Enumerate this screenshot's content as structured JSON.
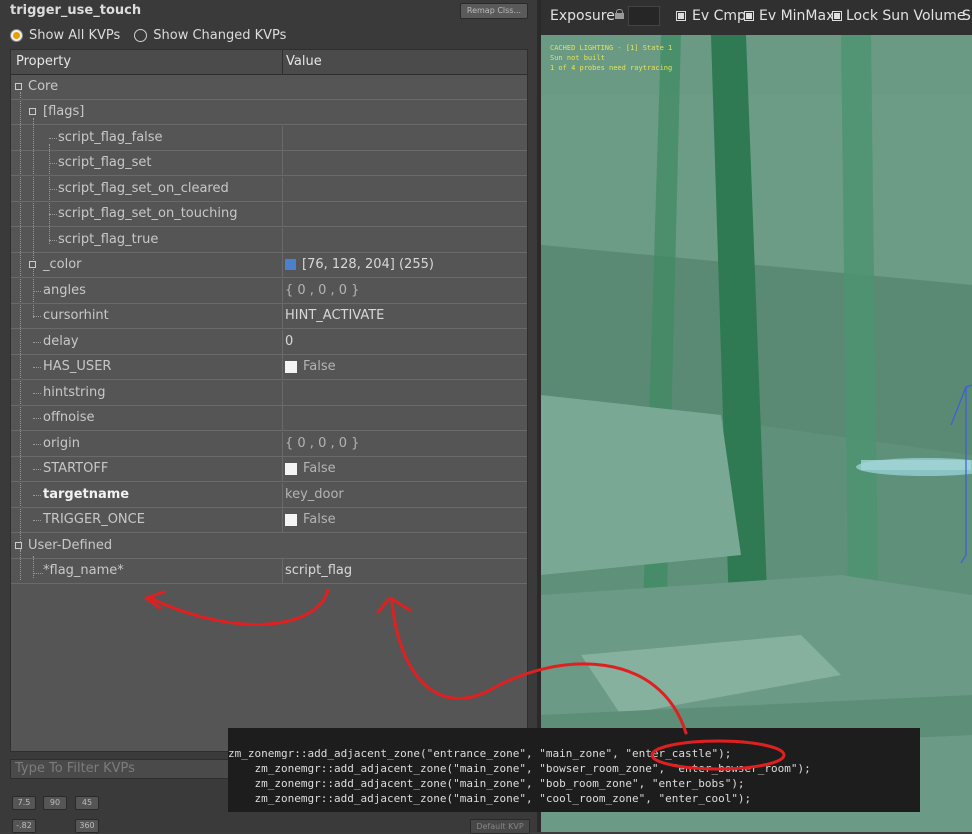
{
  "entity": {
    "classname": "trigger_use_touch",
    "remap_label": "Remap Clss..."
  },
  "filters": {
    "show_all": "Show All KVPs",
    "show_changed": "Show Changed KVPs",
    "selected": "show_all"
  },
  "grid": {
    "headers": {
      "property": "Property",
      "value": "Value"
    },
    "rows": [
      {
        "name": "Core",
        "value": ""
      },
      {
        "name": "[flags]",
        "value": ""
      },
      {
        "name": "script_flag_false",
        "value": ""
      },
      {
        "name": "script_flag_set",
        "value": ""
      },
      {
        "name": "script_flag_set_on_cleared",
        "value": ""
      },
      {
        "name": "script_flag_set_on_touching",
        "value": ""
      },
      {
        "name": "script_flag_true",
        "value": ""
      },
      {
        "name": "_color",
        "value": "[76, 128, 204] (255)"
      },
      {
        "name": "angles",
        "value": "{ 0 , 0 , 0 }"
      },
      {
        "name": "cursorhint",
        "value": "HINT_ACTIVATE"
      },
      {
        "name": "delay",
        "value": "0"
      },
      {
        "name": "HAS_USER",
        "value": "False"
      },
      {
        "name": "hintstring",
        "value": ""
      },
      {
        "name": "offnoise",
        "value": ""
      },
      {
        "name": "origin",
        "value": "{ 0 , 0 , 0 }"
      },
      {
        "name": "STARTOFF",
        "value": "False"
      },
      {
        "name": "targetname",
        "value": "key_door"
      },
      {
        "name": "TRIGGER_ONCE",
        "value": "False"
      },
      {
        "name": "User-Defined",
        "value": ""
      },
      {
        "name": "*flag_name*",
        "value": "script_flag"
      }
    ],
    "color_swatch": "#4c80cc"
  },
  "filter_input": {
    "placeholder": "Type To Filter KVPs"
  },
  "snap_buttons": [
    "7.5",
    "90",
    "45",
    "-.82",
    "360"
  ],
  "default_kvp_label": "Default KVP",
  "viewport": {
    "toolbar": {
      "exposure": "Exposure",
      "ev_cmp": "Ev Cmp",
      "ev_minmax": "Ev MinMax",
      "lock_sun": "Lock Sun Volume",
      "trailing": "S"
    },
    "debug_lines": [
      "CACHED LIGHTING - [1] State 1",
      "Sun not built",
      "1 of 4 probes need raytracing"
    ],
    "background_color": "#5f9079"
  },
  "code": {
    "lines": [
      "zm_zonemgr::add_adjacent_zone(\"entrance_zone\", \"main_zone\", \"enter_castle\");",
      "    zm_zonemgr::add_adjacent_zone(\"main_zone\", \"bowser_room_zone\", \"enter_bowser_room\");",
      "    zm_zonemgr::add_adjacent_zone(\"main_zone\", \"bob_room_zone\", \"enter_bobs\");",
      "    zm_zonemgr::add_adjacent_zone(\"main_zone\", \"cool_room_zone\", \"enter_cool\");"
    ]
  },
  "annotation_color": "#e02020"
}
